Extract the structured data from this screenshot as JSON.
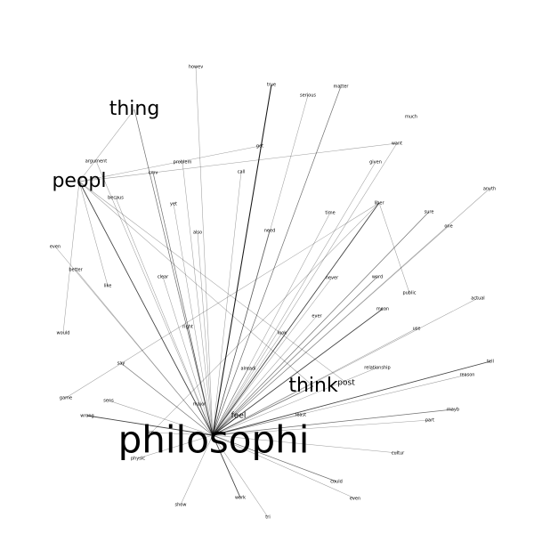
{
  "colors": {
    "background": "#ffffff",
    "text": "#000000",
    "edge": "#000000"
  },
  "nodes": [
    {
      "id": "philosophi",
      "label": "philosophi",
      "size": 3
    },
    {
      "id": "peopl",
      "label": "peopl",
      "size": 2
    },
    {
      "id": "thing",
      "label": "thing",
      "size": 2
    },
    {
      "id": "think",
      "label": "think",
      "size": 2
    },
    {
      "id": "post",
      "label": "post",
      "size": 1
    },
    {
      "id": "feel",
      "label": "feel",
      "size": 1
    },
    {
      "id": "howev",
      "label": "howev",
      "size": 0
    },
    {
      "id": "true",
      "label": "true",
      "size": 0
    },
    {
      "id": "serious",
      "label": "serious",
      "size": 0
    },
    {
      "id": "matter",
      "label": "matter",
      "size": 0
    },
    {
      "id": "much",
      "label": "much",
      "size": 0
    },
    {
      "id": "want",
      "label": "want",
      "size": 0
    },
    {
      "id": "get",
      "label": "get",
      "size": 0
    },
    {
      "id": "argument",
      "label": "argument",
      "size": 0
    },
    {
      "id": "problem",
      "label": "problem",
      "size": 0
    },
    {
      "id": "given",
      "label": "given",
      "size": 0
    },
    {
      "id": "cmv",
      "label": "cmv",
      "size": 0
    },
    {
      "id": "call",
      "label": "call",
      "size": 0
    },
    {
      "id": "anyth",
      "label": "anyth",
      "size": 0
    },
    {
      "id": "becaus",
      "label": "becaus",
      "size": 0
    },
    {
      "id": "yet",
      "label": "yet",
      "size": 0
    },
    {
      "id": "liber",
      "label": "liber",
      "size": 0
    },
    {
      "id": "sure",
      "label": "sure",
      "size": 0
    },
    {
      "id": "time",
      "label": "time",
      "size": 0
    },
    {
      "id": "one",
      "label": "one",
      "size": 0
    },
    {
      "id": "need",
      "label": "need",
      "size": 0
    },
    {
      "id": "also",
      "label": "also",
      "size": 0
    },
    {
      "id": "even_top",
      "label": "even",
      "size": 0
    },
    {
      "id": "better",
      "label": "better",
      "size": 0
    },
    {
      "id": "word",
      "label": "word",
      "size": 0
    },
    {
      "id": "never",
      "label": "never",
      "size": 0
    },
    {
      "id": "clear",
      "label": "clear",
      "size": 0
    },
    {
      "id": "like",
      "label": "like",
      "size": 0
    },
    {
      "id": "public",
      "label": "public",
      "size": 0
    },
    {
      "id": "actual",
      "label": "actual",
      "size": 0
    },
    {
      "id": "mean",
      "label": "mean",
      "size": 0
    },
    {
      "id": "ever",
      "label": "ever",
      "size": 0
    },
    {
      "id": "right",
      "label": "right",
      "size": 0
    },
    {
      "id": "use",
      "label": "use",
      "size": 0
    },
    {
      "id": "would",
      "label": "would",
      "size": 0
    },
    {
      "id": "look",
      "label": "look",
      "size": 0
    },
    {
      "id": "say",
      "label": "say",
      "size": 0
    },
    {
      "id": "tell",
      "label": "tell",
      "size": 0
    },
    {
      "id": "alreadi",
      "label": "alreadi",
      "size": 0
    },
    {
      "id": "relationship",
      "label": "relationship",
      "size": 0
    },
    {
      "id": "reason",
      "label": "reason",
      "size": 0
    },
    {
      "id": "game",
      "label": "game",
      "size": 0
    },
    {
      "id": "sens",
      "label": "sens",
      "size": 0
    },
    {
      "id": "major",
      "label": "major",
      "size": 0
    },
    {
      "id": "least",
      "label": "least",
      "size": 0
    },
    {
      "id": "mayb",
      "label": "mayb",
      "size": 0
    },
    {
      "id": "wrong",
      "label": "wrong",
      "size": 0
    },
    {
      "id": "part",
      "label": "part",
      "size": 0
    },
    {
      "id": "im",
      "label": "im",
      "size": 0
    },
    {
      "id": "physic",
      "label": "physic",
      "size": 0
    },
    {
      "id": "cultur",
      "label": "cultur",
      "size": 0
    },
    {
      "id": "could",
      "label": "could",
      "size": 0
    },
    {
      "id": "even_bottom",
      "label": "even",
      "size": 0
    },
    {
      "id": "show",
      "label": "show",
      "size": 0
    },
    {
      "id": "work",
      "label": "work",
      "size": 0
    },
    {
      "id": "tri",
      "label": "tri",
      "size": 0
    }
  ],
  "edges": [
    {
      "source": "philosophi",
      "target": "howev",
      "weight": 1
    },
    {
      "source": "philosophi",
      "target": "true",
      "weight": 4
    },
    {
      "source": "philosophi",
      "target": "serious",
      "weight": 1
    },
    {
      "source": "philosophi",
      "target": "matter",
      "weight": 2
    },
    {
      "source": "philosophi",
      "target": "want",
      "weight": 1
    },
    {
      "source": "philosophi",
      "target": "given",
      "weight": 1
    },
    {
      "source": "philosophi",
      "target": "call",
      "weight": 1
    },
    {
      "source": "philosophi",
      "target": "problem",
      "weight": 1
    },
    {
      "source": "philosophi",
      "target": "cmv",
      "weight": 2
    },
    {
      "source": "philosophi",
      "target": "thing",
      "weight": 2
    },
    {
      "source": "philosophi",
      "target": "peopl",
      "weight": 3
    },
    {
      "source": "philosophi",
      "target": "argument",
      "weight": 1
    },
    {
      "source": "philosophi",
      "target": "becaus",
      "weight": 1
    },
    {
      "source": "philosophi",
      "target": "yet",
      "weight": 1
    },
    {
      "source": "philosophi",
      "target": "also",
      "weight": 1
    },
    {
      "source": "philosophi",
      "target": "need",
      "weight": 2
    },
    {
      "source": "philosophi",
      "target": "time",
      "weight": 1
    },
    {
      "source": "philosophi",
      "target": "liber",
      "weight": 3
    },
    {
      "source": "philosophi",
      "target": "sure",
      "weight": 2
    },
    {
      "source": "philosophi",
      "target": "one",
      "weight": 1
    },
    {
      "source": "philosophi",
      "target": "anyth",
      "weight": 1
    },
    {
      "source": "philosophi",
      "target": "never",
      "weight": 1
    },
    {
      "source": "philosophi",
      "target": "word",
      "weight": 2
    },
    {
      "source": "philosophi",
      "target": "mean",
      "weight": 3
    },
    {
      "source": "philosophi",
      "target": "ever",
      "weight": 1
    },
    {
      "source": "philosophi",
      "target": "actual",
      "weight": 1
    },
    {
      "source": "philosophi",
      "target": "use",
      "weight": 1
    },
    {
      "source": "philosophi",
      "target": "look",
      "weight": 1
    },
    {
      "source": "philosophi",
      "target": "clear",
      "weight": 1
    },
    {
      "source": "philosophi",
      "target": "right",
      "weight": 1
    },
    {
      "source": "philosophi",
      "target": "alreadi",
      "weight": 1
    },
    {
      "source": "philosophi",
      "target": "better",
      "weight": 1
    },
    {
      "source": "philosophi",
      "target": "even_top",
      "weight": 1
    },
    {
      "source": "philosophi",
      "target": "say",
      "weight": 2
    },
    {
      "source": "philosophi",
      "target": "relationship",
      "weight": 1
    },
    {
      "source": "philosophi",
      "target": "tell",
      "weight": 3
    },
    {
      "source": "philosophi",
      "target": "reason",
      "weight": 1
    },
    {
      "source": "philosophi",
      "target": "mayb",
      "weight": 2
    },
    {
      "source": "philosophi",
      "target": "part",
      "weight": 1
    },
    {
      "source": "philosophi",
      "target": "least",
      "weight": 1
    },
    {
      "source": "philosophi",
      "target": "think",
      "weight": 2
    },
    {
      "source": "philosophi",
      "target": "feel",
      "weight": 2
    },
    {
      "source": "philosophi",
      "target": "major",
      "weight": 1
    },
    {
      "source": "philosophi",
      "target": "sens",
      "weight": 1
    },
    {
      "source": "philosophi",
      "target": "wrong",
      "weight": 3
    },
    {
      "source": "philosophi",
      "target": "im",
      "weight": 1
    },
    {
      "source": "philosophi",
      "target": "physic",
      "weight": 1
    },
    {
      "source": "philosophi",
      "target": "cultur",
      "weight": 1
    },
    {
      "source": "philosophi",
      "target": "could",
      "weight": 2
    },
    {
      "source": "philosophi",
      "target": "even_bottom",
      "weight": 1
    },
    {
      "source": "philosophi",
      "target": "show",
      "weight": 1
    },
    {
      "source": "philosophi",
      "target": "work",
      "weight": 3
    },
    {
      "source": "philosophi",
      "target": "tri",
      "weight": 1
    },
    {
      "source": "peopl",
      "target": "thing",
      "weight": 1
    },
    {
      "source": "peopl",
      "target": "get",
      "weight": 1
    },
    {
      "source": "peopl",
      "target": "want",
      "weight": 1
    },
    {
      "source": "peopl",
      "target": "like",
      "weight": 1
    },
    {
      "source": "peopl",
      "target": "would",
      "weight": 1
    },
    {
      "source": "peopl",
      "target": "post",
      "weight": 1
    },
    {
      "source": "peopl",
      "target": "think",
      "weight": 1
    },
    {
      "source": "liber",
      "target": "public",
      "weight": 1
    },
    {
      "source": "liber",
      "target": "game",
      "weight": 1
    },
    {
      "source": "liber",
      "target": "im",
      "weight": 1
    }
  ]
}
